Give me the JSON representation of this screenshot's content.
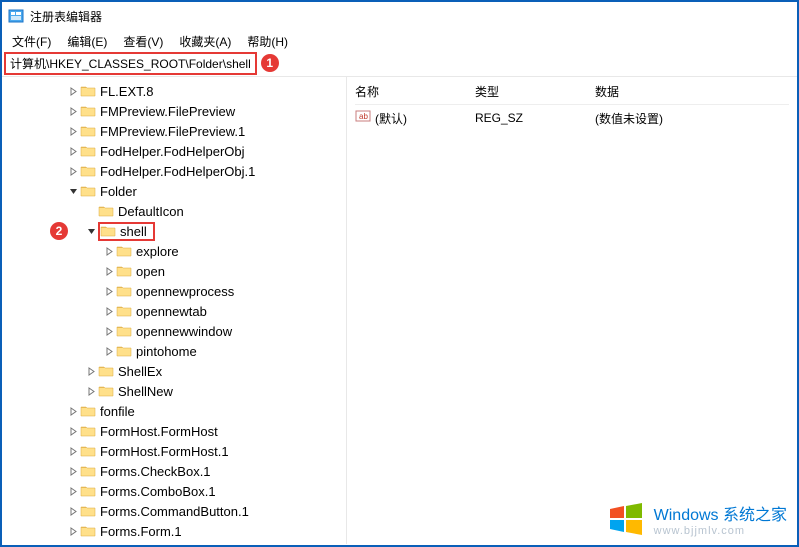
{
  "window": {
    "title": "注册表编辑器"
  },
  "menu": {
    "file": "文件(F)",
    "edit": "编辑(E)",
    "view": "查看(V)",
    "favorites": "收藏夹(A)",
    "help": "帮助(H)"
  },
  "addressbar": {
    "path": "计算机\\HKEY_CLASSES_ROOT\\Folder\\shell"
  },
  "annotations": {
    "badge1": "1",
    "badge2": "2"
  },
  "tree": {
    "items": [
      {
        "indent": 2,
        "exp": "closed",
        "label": "FL.EXT.8"
      },
      {
        "indent": 2,
        "exp": "closed",
        "label": "FMPreview.FilePreview"
      },
      {
        "indent": 2,
        "exp": "closed",
        "label": "FMPreview.FilePreview.1"
      },
      {
        "indent": 2,
        "exp": "closed",
        "label": "FodHelper.FodHelperObj"
      },
      {
        "indent": 2,
        "exp": "closed",
        "label": "FodHelper.FodHelperObj.1"
      },
      {
        "indent": 2,
        "exp": "open",
        "label": "Folder"
      },
      {
        "indent": 3,
        "exp": "none",
        "label": "DefaultIcon"
      },
      {
        "indent": 3,
        "exp": "open",
        "label": "shell",
        "selected": true,
        "badge": "2"
      },
      {
        "indent": 4,
        "exp": "closed",
        "label": "explore"
      },
      {
        "indent": 4,
        "exp": "closed",
        "label": "open"
      },
      {
        "indent": 4,
        "exp": "closed",
        "label": "opennewprocess"
      },
      {
        "indent": 4,
        "exp": "closed",
        "label": "opennewtab"
      },
      {
        "indent": 4,
        "exp": "closed",
        "label": "opennewwindow"
      },
      {
        "indent": 4,
        "exp": "closed",
        "label": "pintohome"
      },
      {
        "indent": 3,
        "exp": "closed",
        "label": "ShellEx"
      },
      {
        "indent": 3,
        "exp": "closed",
        "label": "ShellNew"
      },
      {
        "indent": 2,
        "exp": "closed",
        "label": "fonfile"
      },
      {
        "indent": 2,
        "exp": "closed",
        "label": "FormHost.FormHost"
      },
      {
        "indent": 2,
        "exp": "closed",
        "label": "FormHost.FormHost.1"
      },
      {
        "indent": 2,
        "exp": "closed",
        "label": "Forms.CheckBox.1"
      },
      {
        "indent": 2,
        "exp": "closed",
        "label": "Forms.ComboBox.1"
      },
      {
        "indent": 2,
        "exp": "closed",
        "label": "Forms.CommandButton.1"
      },
      {
        "indent": 2,
        "exp": "closed",
        "label": "Forms.Form.1"
      }
    ]
  },
  "list": {
    "headers": {
      "name": "名称",
      "type": "类型",
      "data": "数据"
    },
    "rows": [
      {
        "name": "(默认)",
        "type": "REG_SZ",
        "data": "(数值未设置)"
      }
    ]
  },
  "watermark": {
    "line1": "Windows 系统之家",
    "line2": "www.bjjmlv.com"
  }
}
